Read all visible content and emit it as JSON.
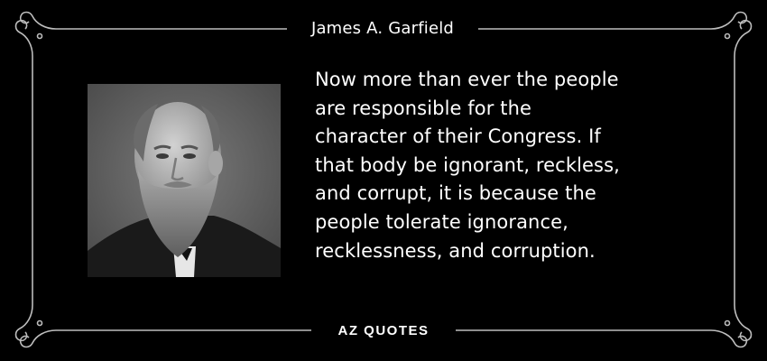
{
  "author": "James A. Garfield",
  "quote_lines": [
    "Now more than ever the people",
    "are responsible for the",
    "character of their Congress. If",
    "that body be ignorant, reckless,",
    "and corrupt, it is because the",
    "people tolerate ignorance,",
    "recklessness, and corruption."
  ],
  "brand": "AZ QUOTES",
  "colors": {
    "background": "#000000",
    "text": "#ffffff",
    "frame": "#bdbdbd"
  }
}
